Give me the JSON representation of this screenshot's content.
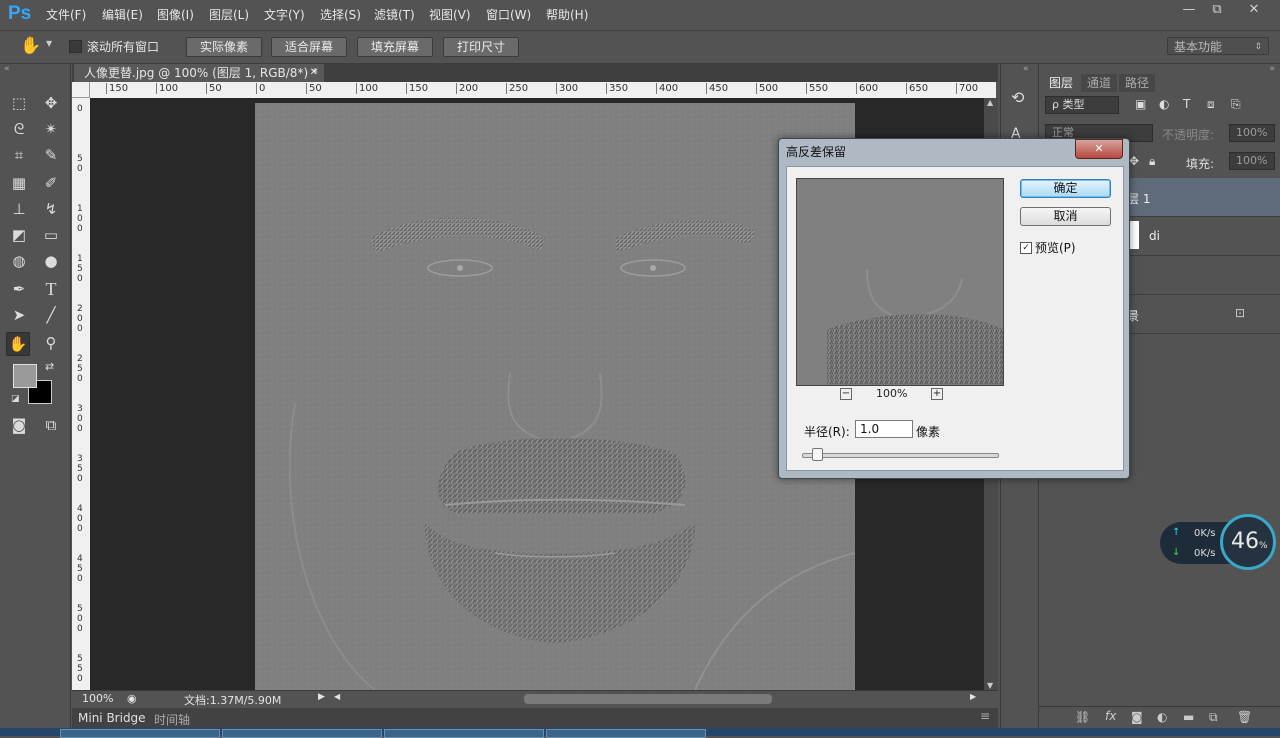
{
  "app": {
    "logo": "Ps"
  },
  "menu": [
    "文件(F)",
    "编辑(E)",
    "图像(I)",
    "图层(L)",
    "文字(Y)",
    "选择(S)",
    "滤镜(T)",
    "视图(V)",
    "窗口(W)",
    "帮助(H)"
  ],
  "window_controls": {
    "minimize": "—",
    "restore": "⧉",
    "close": "✕"
  },
  "options_bar": {
    "scroll_all_label": "滚动所有窗口",
    "buttons": [
      "实际像素",
      "适合屏幕",
      "填充屏幕",
      "打印尺寸"
    ],
    "workspace": "基本功能"
  },
  "document": {
    "tab_title": "人像更替.jpg @ 100% (图层 1, RGB/8*) *",
    "zoom": "100%",
    "doc_info": "文档:1.37M/5.90M",
    "h_ruler_ticks": [
      "150",
      "100",
      "50",
      "0",
      "50",
      "100",
      "150",
      "200",
      "250",
      "300",
      "350",
      "400",
      "450",
      "500",
      "550",
      "600",
      "650",
      "700"
    ],
    "v_ruler_ticks": [
      "0",
      "5\n0",
      "1\n0\n0",
      "1\n5\n0",
      "2\n0\n0",
      "2\n5\n0",
      "3\n0\n0",
      "3\n5\n0",
      "4\n0\n0",
      "4\n5\n0",
      "5\n0\n0",
      "5\n5\n0"
    ]
  },
  "bottom_tabs": [
    "Mini Bridge",
    "时间轴"
  ],
  "layers_panel": {
    "tabs": [
      "图层",
      "通道",
      "路径"
    ],
    "filter_kind": "ρ 类型",
    "blend_mode": "正常",
    "opacity_label": "不透明度:",
    "opacity_value": "100%",
    "lock_label": "锁",
    "fill_label": "填充:",
    "fill_value": "100%",
    "layers": [
      "层 1",
      "di",
      "",
      "景"
    ]
  },
  "dialog": {
    "title": "高反差保留",
    "ok": "确定",
    "cancel": "取消",
    "preview_label": "预览(P)",
    "preview_checked": true,
    "zoom": "100%",
    "radius_label": "半径(R):",
    "radius_value": "1.0",
    "unit": "像素",
    "slider_value": 0.05
  },
  "net_widget": {
    "up": "0K/s",
    "down": "0K/s",
    "percent": "46",
    "percent_unit": "%"
  }
}
